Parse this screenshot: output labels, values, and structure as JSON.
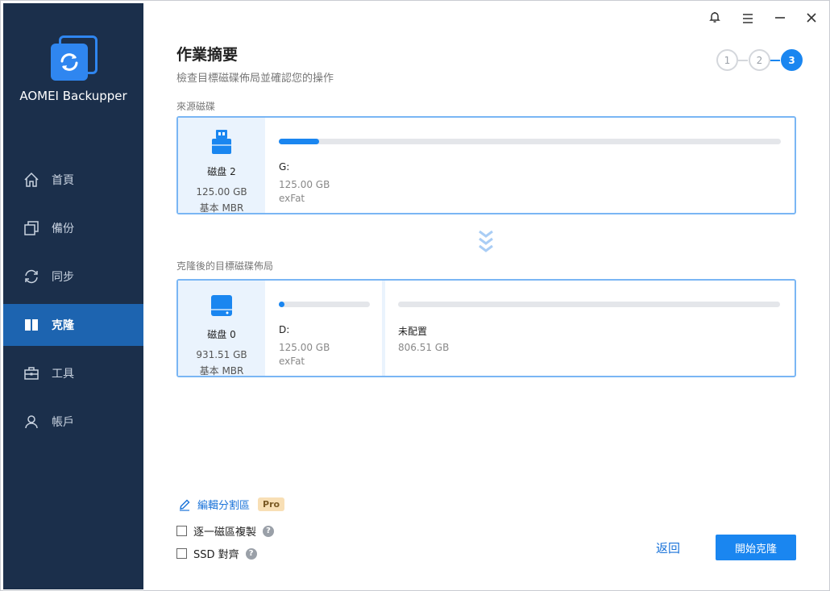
{
  "app": {
    "name": "AOMEI Backupper"
  },
  "sidebar": {
    "items": [
      {
        "label": "首頁",
        "icon": "home-icon"
      },
      {
        "label": "備份",
        "icon": "backup-icon"
      },
      {
        "label": "同步",
        "icon": "sync-icon"
      },
      {
        "label": "克隆",
        "icon": "clone-icon",
        "active": true
      },
      {
        "label": "工具",
        "icon": "toolbox-icon"
      },
      {
        "label": "帳戶",
        "icon": "user-icon"
      }
    ]
  },
  "header": {
    "title": "作業摘要",
    "subtitle": "檢查目標磁碟佈局並確認您的操作",
    "steps": [
      "1",
      "2",
      "3"
    ],
    "active_step": 3
  },
  "source": {
    "label": "來源磁碟",
    "disk": {
      "name": "磁盘 2",
      "size": "125.00 GB",
      "type": "基本 MBR",
      "icon": "usb-drive-icon"
    },
    "partitions": [
      {
        "label": "G:",
        "size": "125.00 GB",
        "fs": "exFat",
        "used_fraction": 0.08
      }
    ]
  },
  "destination": {
    "label": "克隆後的目標磁碟佈局",
    "disk": {
      "name": "磁盘 0",
      "size": "931.51 GB",
      "type": "基本 MBR",
      "icon": "hard-disk-icon"
    },
    "partitions": [
      {
        "label": "D:",
        "size": "125.00 GB",
        "fs": "exFat",
        "used_fraction": 0.06
      },
      {
        "label": "未配置",
        "size": "806.51 GB",
        "fs": "",
        "used_fraction": 0
      }
    ]
  },
  "options": {
    "edit_partition": "編輯分割區",
    "pro": "Pro",
    "sector_by_sector": "逐一磁區複製",
    "ssd_align": "SSD 對齊",
    "help": "?"
  },
  "buttons": {
    "back": "返回",
    "start": "開始克隆"
  },
  "colors": {
    "sidebar": "#1b2f4b",
    "active_nav": "#1d64b0",
    "accent": "#1a86f0"
  }
}
